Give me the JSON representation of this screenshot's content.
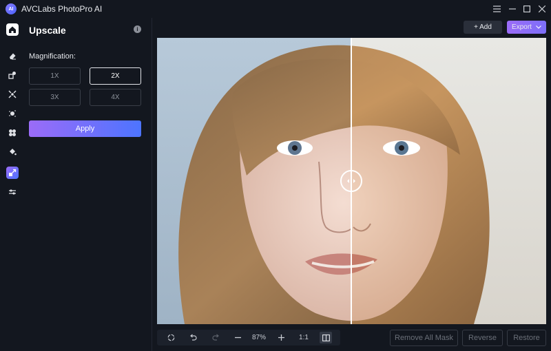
{
  "app": {
    "title": "AVCLabs PhotoPro AI",
    "logo_text": "AI"
  },
  "window_controls": [
    "menu-icon",
    "minimize-icon",
    "maximize-icon",
    "close-icon"
  ],
  "rail": [
    {
      "icon": "home-icon",
      "active": true
    },
    {
      "icon": "eraser-icon"
    },
    {
      "icon": "object-replace-icon"
    },
    {
      "icon": "face-enhance-icon"
    },
    {
      "icon": "background-remove-icon"
    },
    {
      "icon": "colorize-icon"
    },
    {
      "icon": "fill-icon"
    },
    {
      "icon": "upscale-icon",
      "active": true
    },
    {
      "icon": "adjust-icon"
    }
  ],
  "panel": {
    "title": "Upscale",
    "magnification_label": "Magnification:",
    "options": [
      "1X",
      "2X",
      "3X",
      "4X"
    ],
    "selected": "2X",
    "apply_label": "Apply"
  },
  "top_actions": {
    "add_label": "+ Add",
    "export_label": "Export"
  },
  "toolbar": {
    "zoom": "87%",
    "ratio": "1:1"
  },
  "mask_actions": {
    "remove_all": "Remove All Mask",
    "reverse": "Reverse",
    "restore": "Restore"
  },
  "colors": {
    "accent_start": "#9b6cf8",
    "accent_end": "#4d74ff",
    "background": "#13171f"
  }
}
